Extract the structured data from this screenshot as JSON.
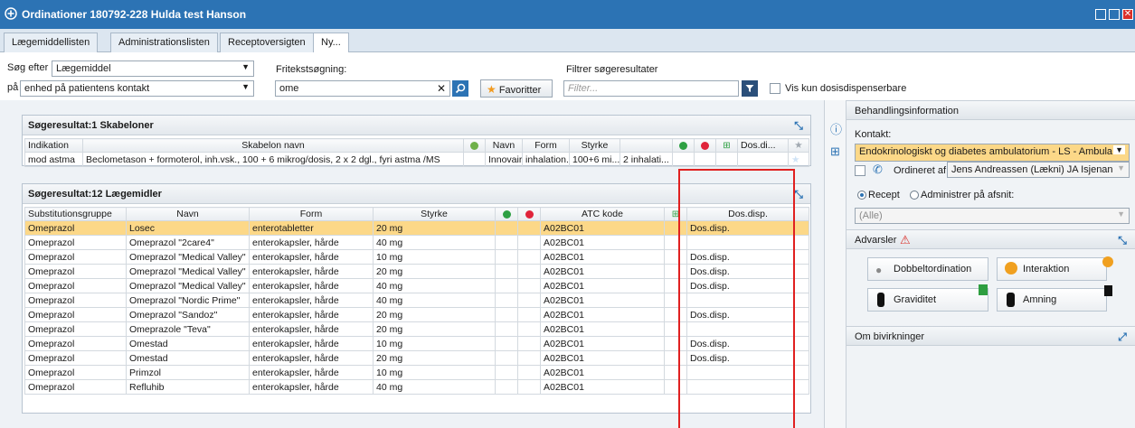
{
  "window": {
    "title": "Ordinationer 180792-228 Hulda test Hanson"
  },
  "tabs": [
    {
      "label": "Lægemiddellisten"
    },
    {
      "label": "Administrationslisten"
    },
    {
      "label": "Receptoversigten"
    },
    {
      "label": "Ny..."
    }
  ],
  "search": {
    "soeg_efter_label": "Søg efter",
    "soeg_efter_value": "Lægemiddel",
    "paa_label": "på",
    "paa_value": "enhed på patientens kontakt",
    "fritekst_label": "Fritekstsøgning:",
    "fritekst_value": "ome",
    "favoritter_label": "Favoritter",
    "filter_label": "Filtrer søgeresultater",
    "filter_placeholder": "Filter...",
    "dosis_checkbox_label": "Vis kun dosisdispenserbare"
  },
  "skabeloner": {
    "title": "Søgeresultat:1 Skabeloner",
    "headers": [
      "Indikation",
      "Skabelon navn",
      "",
      "Navn",
      "Form",
      "Styrke",
      "",
      "",
      "",
      "",
      "Dos.di...",
      ""
    ],
    "rows": [
      [
        "mod astma",
        "Beclometason + formoterol, inh.vsk., 100 + 6 mikrog/dosis, 2 x 2 dgl., fyri astma /MS",
        "",
        "Innovair",
        "inhalation...",
        "100+6 mi...",
        "2 inhalati...",
        "",
        "",
        "",
        "",
        ""
      ]
    ]
  },
  "laegemidler": {
    "title": "Søgeresultat:12 Lægemidler",
    "headers": [
      "Substitutionsgruppe",
      "Navn",
      "Form",
      "Styrke",
      "",
      "",
      "ATC kode",
      "",
      "Dos.disp."
    ],
    "rows": [
      [
        "Omeprazol",
        "Losec",
        "enterotabletter",
        "20 mg",
        "",
        "",
        "A02BC01",
        "",
        "Dos.disp."
      ],
      [
        "Omeprazol",
        "Omeprazol \"2care4\"",
        "enterokapsler, hårde",
        "40 mg",
        "",
        "",
        "A02BC01",
        "",
        ""
      ],
      [
        "Omeprazol",
        "Omeprazol \"Medical Valley\"",
        "enterokapsler, hårde",
        "10 mg",
        "",
        "",
        "A02BC01",
        "",
        "Dos.disp."
      ],
      [
        "Omeprazol",
        "Omeprazol \"Medical Valley\"",
        "enterokapsler, hårde",
        "20 mg",
        "",
        "",
        "A02BC01",
        "",
        "Dos.disp."
      ],
      [
        "Omeprazol",
        "Omeprazol \"Medical Valley\"",
        "enterokapsler, hårde",
        "40 mg",
        "",
        "",
        "A02BC01",
        "",
        "Dos.disp."
      ],
      [
        "Omeprazol",
        "Omeprazol \"Nordic Prime\"",
        "enterokapsler, hårde",
        "40 mg",
        "",
        "",
        "A02BC01",
        "",
        ""
      ],
      [
        "Omeprazol",
        "Omeprazol \"Sandoz\"",
        "enterokapsler, hårde",
        "20 mg",
        "",
        "",
        "A02BC01",
        "",
        "Dos.disp."
      ],
      [
        "Omeprazol",
        "Omeprazole \"Teva\"",
        "enterokapsler, hårde",
        "20 mg",
        "",
        "",
        "A02BC01",
        "",
        ""
      ],
      [
        "Omeprazol",
        "Omestad",
        "enterokapsler, hårde",
        "10 mg",
        "",
        "",
        "A02BC01",
        "",
        "Dos.disp."
      ],
      [
        "Omeprazol",
        "Omestad",
        "enterokapsler, hårde",
        "20 mg",
        "",
        "",
        "A02BC01",
        "",
        "Dos.disp."
      ],
      [
        "Omeprazol",
        "Primzol",
        "enterokapsler, hårde",
        "10 mg",
        "",
        "",
        "A02BC01",
        "",
        ""
      ],
      [
        "Omeprazol",
        "Refluhib",
        "enterokapsler, hårde",
        "40 mg",
        "",
        "",
        "A02BC01",
        "",
        ""
      ]
    ]
  },
  "behandling": {
    "title": "Behandlingsinformation",
    "kontakt_label": "Kontakt:",
    "kontakt_value": "Endokrinologiskt og diabetes ambulatorium - LS - Ambula...",
    "ordineret_label": "Ordineret af:",
    "ordineret_value": "Jens Andreassen (Lækni) JA Isjenan",
    "recept_label": "Recept",
    "administrer_label": "Administrer på afsnit:",
    "afsnit_value": "(Alle)"
  },
  "advarsler": {
    "title": "Advarsler",
    "buttons": [
      "Dobbeltordination",
      "Interaktion",
      "Graviditet",
      "Amning"
    ]
  },
  "bivirkninger": {
    "title": "Om bivirkninger"
  },
  "colors": {
    "accent": "#2c73b4",
    "highlight": "#fcd888",
    "green": "#2ea043",
    "red": "#e0243a",
    "annotation": "#e02020"
  }
}
